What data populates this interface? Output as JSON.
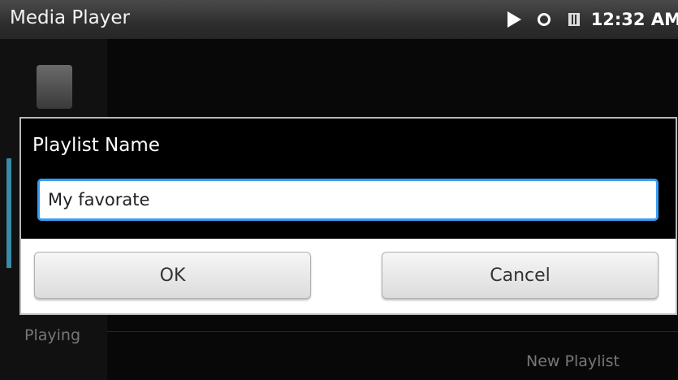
{
  "statusbar": {
    "app_title": "Media Player",
    "icons": [
      "play-icon",
      "sync-icon",
      "sd-card-icon"
    ],
    "clock": "12:32 AM"
  },
  "background": {
    "playing_label": "Playing",
    "new_playlist_label": "New Playlist"
  },
  "dialog": {
    "title": "Playlist Name",
    "input_value": "My favorate",
    "ok_label": "OK",
    "cancel_label": "Cancel"
  },
  "colors": {
    "focus_border": "#3b9cf2",
    "dialog_bg": "#000000",
    "button_bar_bg": "#ffffff"
  }
}
